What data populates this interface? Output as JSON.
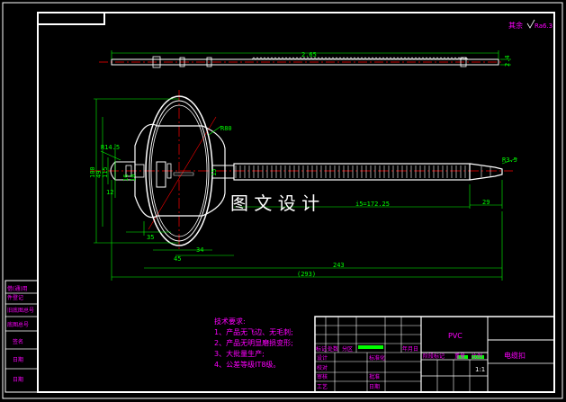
{
  "roughness": {
    "label": "其余",
    "value": "Ra6.3"
  },
  "watermark": "图 文 设 计",
  "dimensions": {
    "top_length": "2.65",
    "top_height": "2.4",
    "r_left": "R14.5",
    "r_top": "R80",
    "r_right": "R3.5",
    "h_100": "100",
    "h_49": "49",
    "h_115": "115",
    "h_12": "12",
    "h_16": "16",
    "h_10": "10",
    "h_15": "15",
    "w_35": "35",
    "w_34": "34",
    "w_45": "45",
    "w_29": "29",
    "pitch": "i5=172.25",
    "w_243": "243",
    "w_293": "(293)"
  },
  "tech_requirements": {
    "title": "技术要求:",
    "items": [
      "1、产品无飞边、无毛刺;",
      "2、产品无明显磨损变形;",
      "3、大批量生产;",
      "4、公差等级IT8级。"
    ]
  },
  "left_strip": [
    "借(通)用",
    "件登记",
    "旧底图总号",
    "底图总号",
    "签名",
    "日期",
    "日期"
  ],
  "title_block": {
    "material": "PVC",
    "part_name": "电缆扣",
    "scale": "1:1",
    "row_labels": [
      "标记",
      "处数",
      "分区",
      "年月日"
    ],
    "left_labels": [
      "设计",
      "校对",
      "审核",
      "工艺"
    ],
    "mid_labels": [
      "标准化",
      "批准",
      "日期"
    ],
    "stage_labels": [
      "阶段标记",
      "重量",
      "比例"
    ]
  }
}
